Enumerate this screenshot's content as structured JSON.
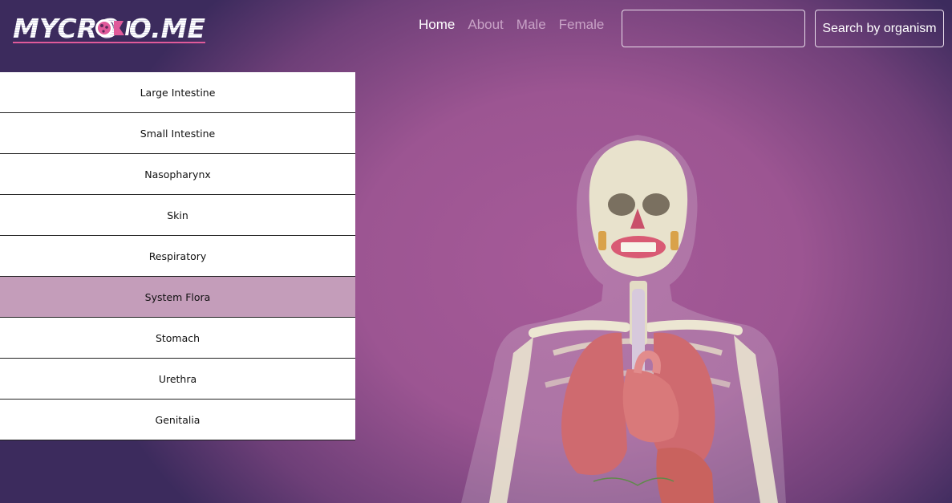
{
  "header": {
    "logo_text": "MYCROBIO.ME",
    "nav": [
      {
        "label": "Home",
        "active": true
      },
      {
        "label": "About",
        "active": false
      },
      {
        "label": "Male",
        "active": false
      },
      {
        "label": "Female",
        "active": false
      }
    ],
    "search": {
      "value": "",
      "placeholder": ""
    },
    "search_button_label": "Search by organism"
  },
  "sidebar": {
    "items": [
      {
        "label": "Large Intestine"
      },
      {
        "label": "Small Intestine"
      },
      {
        "label": "Nasopharynx"
      },
      {
        "label": "Skin"
      },
      {
        "label": "Respiratory"
      },
      {
        "label": "System Flora"
      },
      {
        "label": "Stomach"
      },
      {
        "label": "Urethra"
      },
      {
        "label": "Genitalia"
      }
    ],
    "selected_label": "System Flora"
  },
  "colors": {
    "accent": "#a65a98",
    "selected_item": "#c49dba",
    "logo_pink": "#e05a9a"
  }
}
